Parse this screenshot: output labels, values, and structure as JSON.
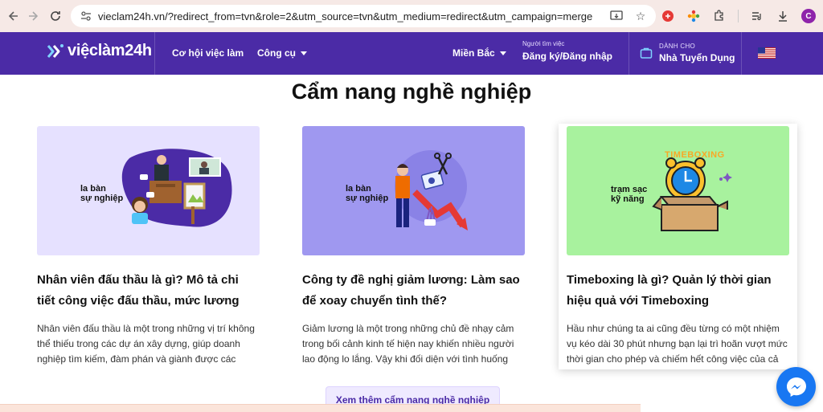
{
  "browser": {
    "url": "vieclam24h.vn/?redirect_from=tvn&role=2&utm_source=tvn&utm_medium=redirect&utm_campaign=merge",
    "profile_initial": "C"
  },
  "header": {
    "logo_text": "việclàm24h",
    "menu": {
      "jobs": "Cơ hội việc làm",
      "tools": "Công cụ",
      "region": "Miền Bắc"
    },
    "login": {
      "small": "Người tìm việc",
      "main": "Đăng ký/Đăng nhập"
    },
    "employer": {
      "small": "DÀNH CHO",
      "main": "Nhà Tuyển Dụng"
    }
  },
  "section": {
    "title": "Cẩm nang nghề nghiệp"
  },
  "cards": [
    {
      "brand_line1": "la bàn",
      "brand_line2": "sự nghiệp",
      "title": "Nhân viên đấu thầu là gì? Mô tả chi tiết công việc đấu thầu, mức lương ra...",
      "desc": "Nhân viên đấu thầu là một trong những vị trí không thể thiếu trong các dự án xây dựng, giúp doanh nghiệp tìm kiếm, đàm phán và giành được các hợp..."
    },
    {
      "brand_line1": "la bàn",
      "brand_line2": "sự nghiệp",
      "title": "Công ty đề nghị giảm lương: Làm sao để xoay chuyển tình thế?",
      "desc": "Giảm lương là một trong những chủ đề nhạy cảm trong bối cảnh kinh tế hiện nay khiến nhiều người lao động lo lắng. Vậy khi đối diện với tình huống này, li..."
    },
    {
      "banner": "TIMEBOXING",
      "brand_line1": "trạm sạc",
      "brand_line2": "kỹ năng",
      "title": "Timeboxing là gì? Quản lý thời gian hiệu quả với Timeboxing",
      "desc": "Hầu như chúng ta ai cũng đều từng có một nhiệm vụ kéo dài 30 phút nhưng bạn lại trì hoãn vượt mức thời gian cho phép và chiếm hết công việc của cả ngày...."
    }
  ],
  "more_button": "Xem thêm cẩm nang nghề nghiệp",
  "colors": {
    "header_bg": "#4b2ba6",
    "card1_bg": "#e6e1ff",
    "card2_bg": "#9f98f0",
    "card3_bg": "#a8f29e",
    "messenger": "#1877f2"
  }
}
